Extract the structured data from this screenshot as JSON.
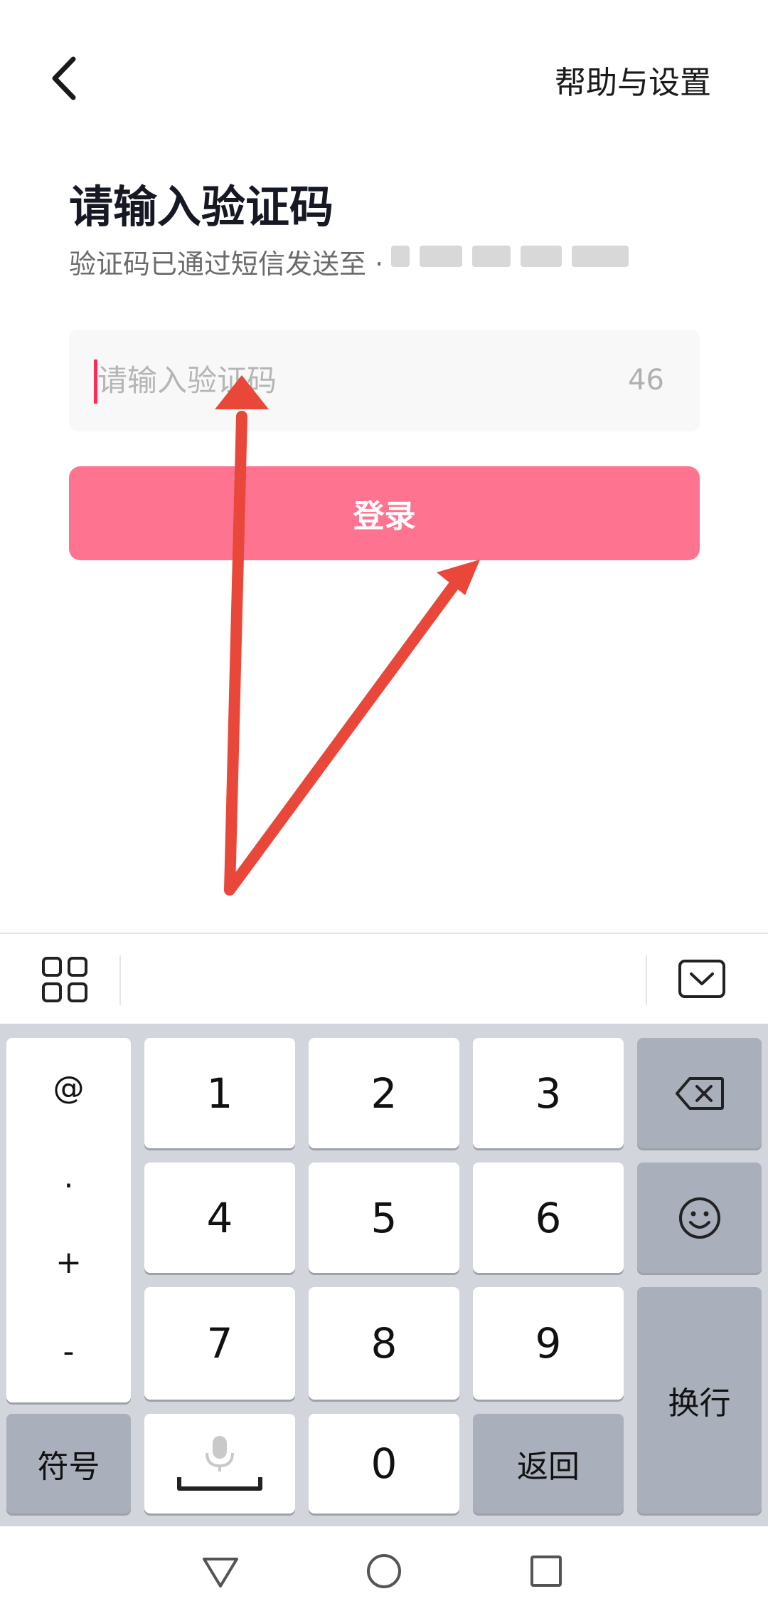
{
  "header": {
    "back_icon": "chevron-left-icon",
    "help_label": "帮助与设置"
  },
  "verify": {
    "title": "请输入验证码",
    "subtitle": "验证码已通过短信发送至 ·",
    "input_placeholder": "请输入验证码",
    "input_value": "",
    "countdown": "46",
    "login_label": "登录",
    "accent_color": "#fe2c55",
    "button_color": "#fe7490"
  },
  "keyboard": {
    "toolbar": {
      "left_icon": "grid-icon",
      "right_icon": "keyboard-hide-icon"
    },
    "symbols": [
      "@",
      ".",
      "+",
      "-"
    ],
    "digits": [
      "1",
      "2",
      "3",
      "4",
      "5",
      "6",
      "7",
      "8",
      "9",
      "0"
    ],
    "symbol_key": "符号",
    "return_key": "返回",
    "newline_key": "换行",
    "space_icon": "microphone-icon",
    "backspace_icon": "backspace-icon",
    "emoji_icon": "emoji-icon"
  },
  "navbar": {
    "back_icon": "triangle-back-icon",
    "home_icon": "circle-home-icon",
    "recents_icon": "square-recents-icon"
  }
}
